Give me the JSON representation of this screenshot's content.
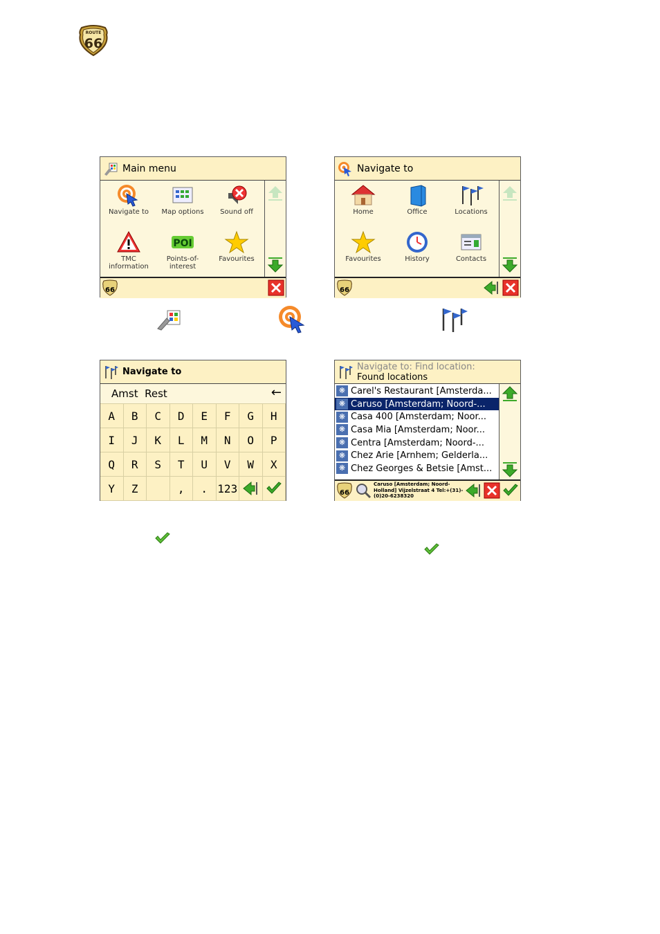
{
  "logo": {
    "top": "ROUTE",
    "num": "66"
  },
  "main_menu": {
    "title": "Main menu",
    "items": [
      "Navigate to",
      "Map options",
      "Sound off",
      "TMC information",
      "Points-of-interest",
      "Favourites"
    ]
  },
  "navigate_to": {
    "title": "Navigate to",
    "items": [
      "Home",
      "Office",
      "Locations",
      "Favourites",
      "History",
      "Contacts"
    ]
  },
  "keyboard": {
    "title": "Navigate to",
    "input": "Amst  Rest",
    "backspace": "←",
    "keys": [
      "A",
      "B",
      "C",
      "D",
      "E",
      "F",
      "G",
      "H",
      "I",
      "J",
      "K",
      "L",
      "M",
      "N",
      "O",
      "P",
      "Q",
      "R",
      "S",
      "T",
      "U",
      "V",
      "W",
      "X",
      "Y",
      "Z",
      "",
      ",",
      ".",
      "123"
    ]
  },
  "found": {
    "title1": "Navigate to: Find location:",
    "title2": "Found locations",
    "rows": [
      "Carel's Restaurant [Amsterda...",
      "Caruso [Amsterdam; Noord-...",
      "Casa 400 [Amsterdam; Noor...",
      "Casa Mia [Amsterdam; Noor...",
      "Centra [Amsterdam; Noord-...",
      "Chez Arie [Arnhem; Gelderla...",
      "Chez Georges & Betsie [Amst..."
    ],
    "selected": 1,
    "detail": "Caruso [Amsterdam; Noord-Holland] Vijzelstraat 4 Tel:+(31)-(0)20-6238320"
  },
  "colors": {
    "accent": "#0a246a",
    "cream": "#fdf1c4",
    "green": "#3daa2a",
    "red": "#e8322a"
  }
}
